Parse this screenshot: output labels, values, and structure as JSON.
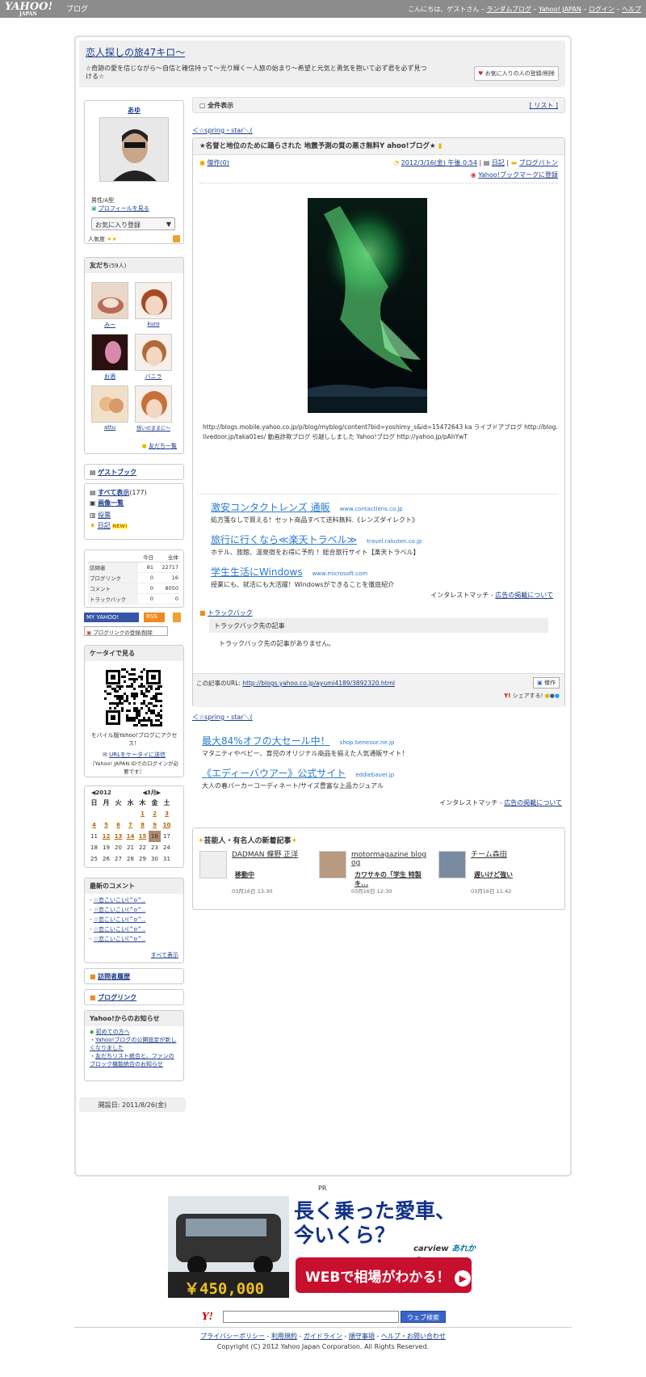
{
  "header": {
    "logo": "YAHOO!",
    "logo_sub": "JAPAN",
    "logo_blog": "ブログ",
    "greeting": "こんにちは、ゲストさん",
    "random_blog": "ランダムブログ",
    "yahoo_japan": "Yahoo! JAPAN",
    "login": "ログイン",
    "help": "ヘルプ"
  },
  "blog": {
    "title": "恋人探しの旅47キロ〜",
    "subtitle": "☆奇跡の愛を信じながら〜自信と確信持って〜光り輝く一人旅の始まり〜希望と元気と勇気を抱いて必ず君を必ず見つける☆",
    "fav_button": "お気に入りの人の登録/削除"
  },
  "profile": {
    "name": "あゆ",
    "meta": "男性/A型",
    "profile_link": "プロフィールを見る",
    "fav_register": "お気に入り登録",
    "popularity": "人気度"
  },
  "friends": {
    "title": "友だち",
    "count": "(59人)",
    "items": [
      "みー",
      "kuro",
      "お酒",
      "バニラ",
      "attu",
      "想いのままに〜"
    ],
    "all_link": "友だち一覧"
  },
  "guestbook": "ゲストブック",
  "menu": {
    "all": "すべて表示",
    "all_count": "(177)",
    "images": "画像一覧",
    "votes": "投票",
    "diary": "日記",
    "new_badge": "NEW!"
  },
  "stats": {
    "headers": [
      "",
      "今日",
      "全体"
    ],
    "rows": [
      [
        "訪問者",
        "81",
        "22717"
      ],
      [
        "ブログリンク",
        "0",
        "16"
      ],
      [
        "コメント",
        "0",
        "8050"
      ],
      [
        "トラックバック",
        "0",
        "0"
      ]
    ]
  },
  "badges": {
    "my_yahoo": "MY YAHOO!",
    "rss": "RSS",
    "bloglink_reg": "ブログリンクの登録/削除"
  },
  "mobile": {
    "title": "ケータイで見る",
    "desc": "モバイル版Yahoo!ブログにアクセス！",
    "send_link": "URLをケータイに送信",
    "note": "（Yahoo! JAPAN IDでのログインが必要です）"
  },
  "calendar": {
    "year": "2012",
    "month": "3月",
    "days": [
      "日",
      "月",
      "火",
      "水",
      "木",
      "金",
      "土"
    ],
    "weeks": [
      [
        "",
        "",
        "",
        "",
        "1",
        "2",
        "3"
      ],
      [
        "4",
        "5",
        "6",
        "7",
        "8",
        "9",
        "10"
      ],
      [
        "11",
        "12",
        "13",
        "14",
        "15",
        "16",
        "17"
      ],
      [
        "18",
        "19",
        "20",
        "21",
        "22",
        "23",
        "24"
      ],
      [
        "25",
        "26",
        "27",
        "28",
        "29",
        "30",
        "31"
      ]
    ],
    "linked": [
      "1",
      "2",
      "3",
      "4",
      "5",
      "6",
      "7",
      "8",
      "9",
      "10",
      "12",
      "13",
      "14",
      "15"
    ]
  },
  "comments": {
    "title": "最新のコメント",
    "items": [
      "☆恋こいこい(^o^..",
      "☆恋こいこい(^o^..",
      "☆恋こいこい(^o^..",
      "☆恋こいこい(^o^..",
      "☆恋こいこい(^o^.."
    ],
    "all": "すべて表示"
  },
  "visitor_history": "訪問者履歴",
  "bloglink": "ブログリンク",
  "notices": {
    "title": "Yahoo!からのお知らせ",
    "first": "初めての方へ",
    "items": [
      "Yahoo!ブログの公開設定が新しくなりました",
      "友だちリスト統合と、ファンのブロック機能統合のお知らせ"
    ]
  },
  "opened": "開設日: 2011/8/26(金)",
  "main": {
    "view_all": "全件表示",
    "list": "[ リスト ]",
    "nav_prev": "＜☆spring・star＼(",
    "article": {
      "title": "★名誉と地位のために踊らされた 地震予測の質の悪さ無料Y ahoo!ブログ★",
      "masterpiece": "傑作(0)",
      "date": "2012/3/16(金) 午後 0:54",
      "category": "日記",
      "category2": "ブログバトン",
      "bookmark": "Yahoo!ブックマークに登録",
      "body": "http://blogs.mobile.yahoo.co.jp/p/blog/myblog/content?bid=yoshimy_s&id=15472643 ka ライブドアブログ http://blog.livedoor.jp/taka01es/ 動画詐欺ブログ 引越ししました Yahoo!ブログ http://yahoo.jp/pAhYwT"
    },
    "ads": [
      {
        "title": "激安コンタクトレンズ 通販",
        "url": "www.contactlens.co.jp",
        "desc": "処方箋なしで買える！セット商品すべて送料無料.《レンズダイレクト》"
      },
      {
        "title": "旅行に行くなら≪楽天トラベル≫",
        "url": "travel.rakuten.co.jp",
        "desc": "ホテル、旅館、温泉宿をお得に予約 ！総合旅行サイト【楽天トラベル】"
      },
      {
        "title": "学生生活にWindows",
        "url": "www.microsoft.com",
        "desc": "授業にも、就活にも大活躍！Windowsができることを徹底紹介"
      }
    ],
    "ad_credit": "インタレストマッチ -",
    "ad_link": "広告の掲載について",
    "trackback": {
      "title": "トラックバック",
      "header": "トラックバック先の記事",
      "empty": "トラックバック先の記事がありません。"
    },
    "article_url_label": "この記事のURL:",
    "article_url": "http://blogs.yahoo.co.jp/ayumi4189/3892320.html",
    "masterpiece_btn": "傑作",
    "share": "シェアする!",
    "ads2": [
      {
        "title": "最大84%オフの大セール中！",
        "url": "shop.benesse.ne.jp",
        "desc": "マタニティやベビー、育児のオリジナル商品を揃えた人気通販サイト！"
      },
      {
        "title": "《エディーバウアー》公式サイト",
        "url": "eddiebauer.jp",
        "desc": "大人の春バーカーコーディネート/サイズ豊富な上品カジュアル"
      }
    ],
    "celeb": {
      "title": "芸能人・有名人の新着記事",
      "items": [
        {
          "name": "DADMAN 蝶野 正洋",
          "post": "移動中",
          "date": "03月16日 13:30"
        },
        {
          "name": "motormagazine blog og",
          "post": "カワサキの「学生 特製キ...",
          "date": "03月16日 12:30"
        },
        {
          "name": "チーム森田",
          "post": "遅いけど強い",
          "date": "03月16日 11:42"
        }
      ]
    }
  },
  "bottom": {
    "pr": "PR",
    "banner_title_1": "長く乗った愛車、",
    "banner_title_2": "今いくら？",
    "banner_brand": "carview",
    "banner_brand2": "あれかう",
    "price": "￥450,000",
    "cta": "WEBで相場がわかる！",
    "search_logo": "Y!",
    "search_btn": "ウェブ検索",
    "links": [
      "プライバシーポリシー",
      "利用規約",
      "ガイドライン",
      "順守事項",
      "ヘルプ・お問い合わせ"
    ],
    "copyright": "Copyright (C) 2012 Yahoo Japan Corporation. All Rights Reserved."
  }
}
